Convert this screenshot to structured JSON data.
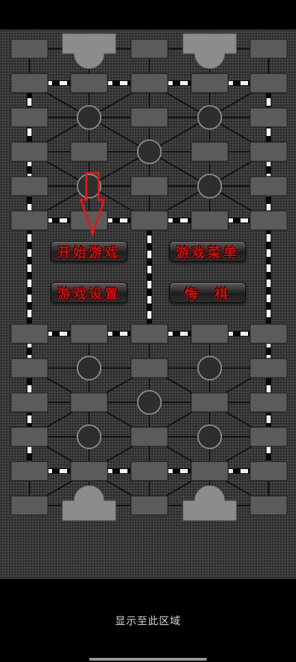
{
  "menu": {
    "start_game": "开始游戏",
    "game_menu": "游戏菜单",
    "game_settings": "游戏设置",
    "undo_move": "悔  棋"
  },
  "footer": {
    "hint": "显示至此区域"
  },
  "colors": {
    "board_bg": "#3a3a3a",
    "slot_fill": "#5b5b5b",
    "camp_fill": "#8c8c8c",
    "line": "#111111",
    "button_text": "#d01010",
    "arrow": "#e01818"
  },
  "icons": {
    "arrow": "down-arrow-icon"
  }
}
